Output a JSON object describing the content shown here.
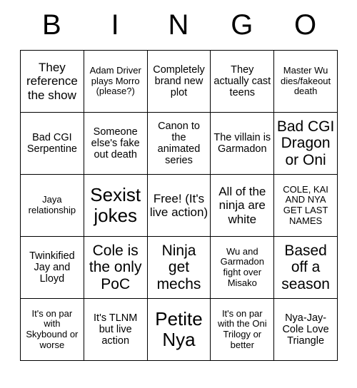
{
  "card": {
    "header_letters": [
      "B",
      "I",
      "N",
      "G",
      "O"
    ],
    "rows": [
      [
        {
          "text": "They reference the show",
          "size": "fs-l"
        },
        {
          "text": "Adam Driver plays Morro (please?)",
          "size": "fs-s"
        },
        {
          "text": "Completely brand new plot",
          "size": "fs-m"
        },
        {
          "text": "They actually cast teens",
          "size": "fs-m"
        },
        {
          "text": "Master Wu dies/fakeout death",
          "size": "fs-s"
        }
      ],
      [
        {
          "text": "Bad CGI Serpentine",
          "size": "fs-m"
        },
        {
          "text": "Someone else's fake out death",
          "size": "fs-m"
        },
        {
          "text": "Canon to the animated series",
          "size": "fs-m"
        },
        {
          "text": "The villain is Garmadon",
          "size": "fs-m"
        },
        {
          "text": "Bad CGI Dragon or Oni",
          "size": "fs-xl"
        }
      ],
      [
        {
          "text": "Jaya relationship",
          "size": "fs-s"
        },
        {
          "text": "Sexist jokes",
          "size": "fs-xxl"
        },
        {
          "text": "Free! (It's live action)",
          "size": "fs-l"
        },
        {
          "text": "All of the ninja are white",
          "size": "fs-l"
        },
        {
          "text": "COLE, KAI AND NYA GET LAST NAMES",
          "size": "fs-s"
        }
      ],
      [
        {
          "text": "Twinkified Jay and Lloyd",
          "size": "fs-m"
        },
        {
          "text": "Cole is the only PoC",
          "size": "fs-xl"
        },
        {
          "text": "Ninja get mechs",
          "size": "fs-xl"
        },
        {
          "text": "Wu and Garmadon fight over Misako",
          "size": "fs-s"
        },
        {
          "text": "Based off a season",
          "size": "fs-xl"
        }
      ],
      [
        {
          "text": "It's on par with Skybound or worse",
          "size": "fs-s"
        },
        {
          "text": "It's TLNM but live action",
          "size": "fs-m"
        },
        {
          "text": "Petite Nya",
          "size": "fs-xxl"
        },
        {
          "text": "It's on par with the Oni Trilogy or better",
          "size": "fs-s"
        },
        {
          "text": "Nya-Jay-Cole Love Triangle",
          "size": "fs-m"
        }
      ]
    ]
  }
}
